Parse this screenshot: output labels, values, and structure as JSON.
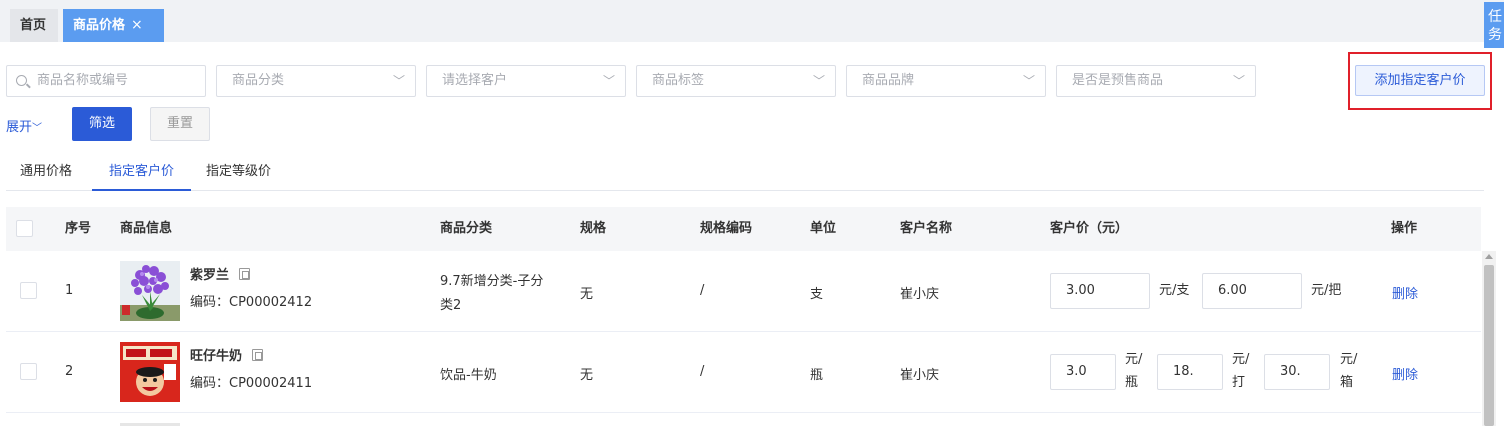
{
  "tabs": {
    "home": "首页",
    "current": "商品价格",
    "close_icon": "×"
  },
  "side_tab": "任务",
  "filters": {
    "search_placeholder": "商品名称或编号",
    "category": "商品分类",
    "customer": "请选择客户",
    "tag": "商品标签",
    "brand": "商品品牌",
    "presale": "是否是预售商品"
  },
  "actions": {
    "add_customer_price": "添加指定客户价",
    "expand": "展开",
    "filter": "筛选",
    "reset": "重置"
  },
  "subtabs": [
    "通用价格",
    "指定客户价",
    "指定等级价"
  ],
  "active_subtab": "指定客户价",
  "table": {
    "headers": [
      "序号",
      "商品信息",
      "商品分类",
      "规格",
      "规格编码",
      "单位",
      "客户名称",
      "客户价（元）",
      "操作"
    ],
    "rows": [
      {
        "index": "1",
        "name": "紫罗兰",
        "code": "编码：CP00002412",
        "category_line1": "9.7新增分类-子分",
        "category_line2": "类2",
        "spec": "无",
        "spec_code": "/",
        "unit": "支",
        "customer": "崔小庆",
        "prices": [
          {
            "value": "3.00",
            "unit": "元/支"
          },
          {
            "value": "6.00",
            "unit": "元/把"
          }
        ],
        "action": "删除"
      },
      {
        "index": "2",
        "name": "旺仔牛奶",
        "code": "编码：CP00002411",
        "category": "饮品-牛奶",
        "spec": "无",
        "spec_code": "/",
        "unit": "瓶",
        "customer": "崔小庆",
        "prices": [
          {
            "value": "3.0",
            "unit_line1": "元/",
            "unit_line2": "瓶"
          },
          {
            "value": "18.",
            "unit_line1": "元/",
            "unit_line2": "打"
          },
          {
            "value": "30.",
            "unit_line1": "元/",
            "unit_line2": "箱"
          }
        ],
        "action": "删除"
      }
    ]
  },
  "colors": {
    "primary": "#2b5bd7",
    "tab_active": "#5b9cf0",
    "highlight_frame": "#e0202a"
  }
}
